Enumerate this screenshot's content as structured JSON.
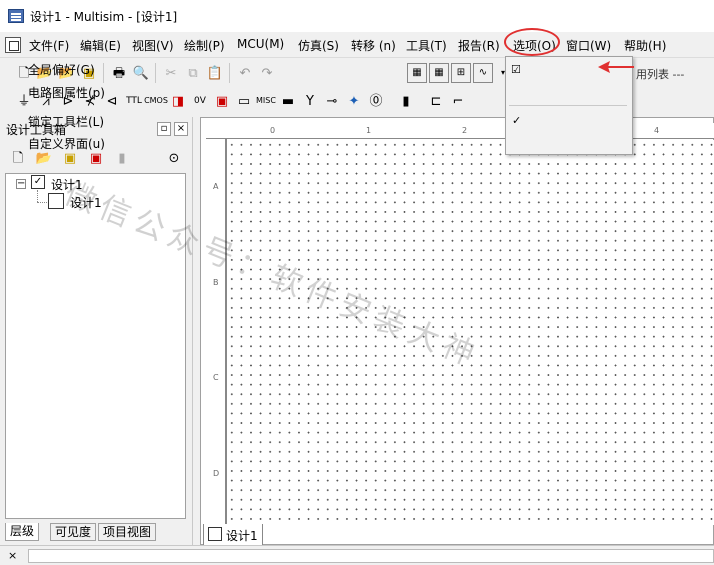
{
  "window": {
    "title": "设计1 - Multisim - [设计1]"
  },
  "menubar": {
    "items": [
      "文件(F)",
      "编辑(E)",
      "视图(V)",
      "绘制(P)",
      "MCU(M)",
      "仿真(S)",
      "转移 (n)",
      "工具(T)",
      "报告(R)",
      "选项(O)",
      "窗口(W)",
      "帮助(H)"
    ]
  },
  "options_menu": {
    "items": [
      {
        "label": "全局偏好(G)"
      },
      {
        "label": "电路图属性(p)"
      },
      {
        "label": "锁定工具栏(L)"
      },
      {
        "label": "自定义界面(u)"
      }
    ],
    "partial_hidden_text": "用列表 ---"
  },
  "toolbox": {
    "title": "设计工具箱",
    "tree_root": "设计1",
    "tree_child": "设计1",
    "tabs": [
      "层级",
      "可见度",
      "项目视图"
    ],
    "close_label": "×"
  },
  "toolbar2": {
    "misc_label": "MISC"
  },
  "canvas": {
    "col_labels": [
      "0",
      "1",
      "2",
      "3",
      "4"
    ],
    "row_labels": [
      "A",
      "B",
      "C",
      "D"
    ],
    "tab_label": "设计1"
  },
  "watermark": {
    "text": "微信公众号：软件安装大神"
  },
  "colors": {
    "annotation": "#e03030",
    "accent": "#0b4a9e"
  }
}
